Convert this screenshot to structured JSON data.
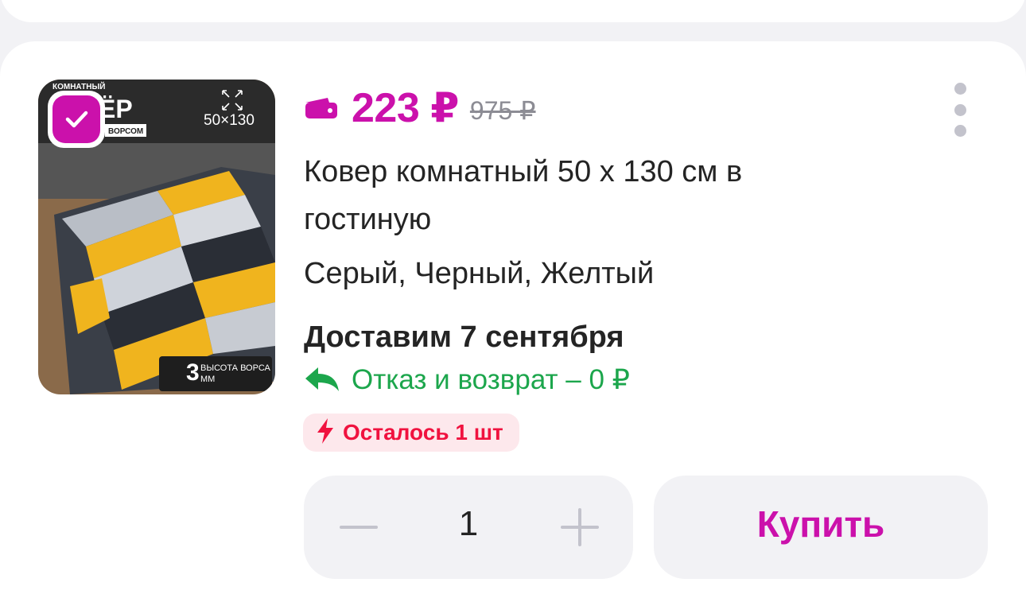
{
  "product": {
    "image": {
      "badge_top": "КОМНАТНЫЙ",
      "badge_title": "ЁР",
      "badge_sub": "ВОРСОМ",
      "size_label": "50×130",
      "pile_height": "3",
      "pile_caption_1": "ВЫСОТА ВОРСА",
      "pile_caption_2": "ММ"
    },
    "selected": true,
    "price_current": "223 ₽",
    "price_old": "975 ₽",
    "title": "Ковер комнатный 50 х 130 см в гостиную",
    "color": "Серый, Черный, Желтый",
    "delivery": "Доставим 7 сентября",
    "refund": "Отказ и возврат – 0 ₽",
    "stock": "Осталось 1 шт"
  },
  "quantity": {
    "value": "1"
  },
  "actions": {
    "buy_label": "Купить"
  },
  "icons": {
    "checkbox": "check-icon",
    "wallet": "wallet-icon",
    "more": "more-vertical-icon",
    "refund": "return-arrow-icon",
    "stock": "lightning-icon",
    "minus": "minus-icon",
    "plus": "plus-icon"
  },
  "colors": {
    "accent": "#cb11ab",
    "refund_green": "#1ca64c",
    "stock_red": "#f0123f",
    "stock_bg": "#fde8ec",
    "text": "#242424",
    "muted": "#8c8c94"
  }
}
